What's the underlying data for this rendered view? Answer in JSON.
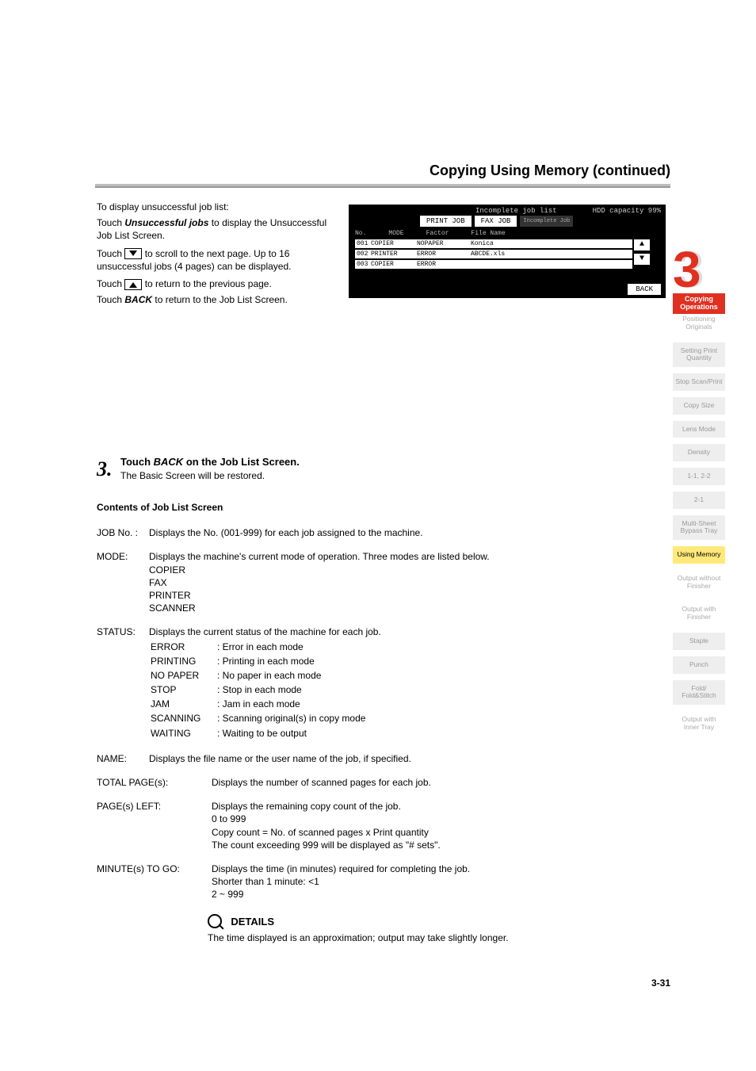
{
  "title": "Copying Using Memory (continued)",
  "intro": {
    "heading": "To display unsuccessful job list:",
    "line1_pre": "Touch ",
    "line1_em": "Unsuccessful jobs",
    "line1_post": " to display the Unsuccessful Job List Screen.",
    "line2_pre": "Touch ",
    "line2_post": " to scroll to the next page. Up to 16 unsuccessful jobs (4 pages) can be displayed.",
    "line3_pre": "Touch ",
    "line3_post": " to return to the previous page.",
    "line4_pre": "Touch ",
    "line4_em": "BACK",
    "line4_post": " to return to the Job List Screen."
  },
  "step3": {
    "num": "3.",
    "head_pre": "Touch ",
    "head_em": "BACK",
    "head_post": " on the Job List Screen.",
    "body": "The Basic Screen will be restored."
  },
  "contents_heading": "Contents of Job List Screen",
  "defs": {
    "jobno_label": "JOB No. :",
    "jobno_body": "Displays the No. (001-999) for each job assigned to the machine.",
    "mode_label": "MODE:",
    "mode_body": "Displays the machine's current mode of operation. Three modes are listed below.",
    "mode_items": [
      "COPIER",
      "FAX",
      "PRINTER",
      "SCANNER"
    ],
    "status_label": "STATUS:",
    "status_body": "Displays the current status of the machine for each job.",
    "status_rows": [
      [
        "ERROR",
        ": Error in each mode"
      ],
      [
        "PRINTING",
        ": Printing in each mode"
      ],
      [
        "NO PAPER",
        ": No paper in each mode"
      ],
      [
        "STOP",
        ": Stop in each mode"
      ],
      [
        "JAM",
        ": Jam in each mode"
      ],
      [
        "SCANNING",
        ": Scanning original(s) in copy mode"
      ],
      [
        "WAITING",
        ": Waiting to be output"
      ]
    ],
    "name_label": "NAME:",
    "name_body": "Displays the file name or the user name of the job, if specified.",
    "total_label": "TOTAL PAGE(s):",
    "total_body": "Displays the number of scanned pages for each job.",
    "pages_label": "PAGE(s) LEFT:",
    "pages_body1": "Displays the remaining copy count of the job.",
    "pages_body2": "0 to 999",
    "pages_body3": "Copy count = No. of scanned pages x Print quantity",
    "pages_body4": "The count exceeding 999 will be displayed as \"# sets\".",
    "minute_label": "MINUTE(s) TO GO:",
    "minute_body1": "Displays the time (in minutes) required for completing the job.",
    "minute_body2": "Shorter than 1 minute: <1",
    "minute_body3": "2 ~ 999"
  },
  "details": {
    "heading": "DETAILS",
    "body": "The time displayed is an approximation; output may take slightly longer."
  },
  "screenshot": {
    "header": "Incomplete job list",
    "hdd": "HDD capacity 99%",
    "tabs": [
      "PRINT JOB",
      "FAX JOB",
      "Incomplete Job"
    ],
    "cols": [
      "No.",
      "MODE",
      "Factor",
      "File Name"
    ],
    "rows": [
      {
        "no": "001",
        "mode": "COPIER",
        "factor": "NOPAPER",
        "name": "Konica"
      },
      {
        "no": "002",
        "mode": "PRINTER",
        "factor": "ERROR",
        "name": "ABCDE.xls"
      },
      {
        "no": "003",
        "mode": "COPIER",
        "factor": "ERROR",
        "name": ""
      }
    ],
    "back": "BACK"
  },
  "chapter": {
    "num": "3",
    "label1": "Copying",
    "label2": "Operations"
  },
  "nav": [
    {
      "text": "Positioning Originals",
      "style": "plain"
    },
    {
      "text": "Setting Print Quantity",
      "style": "shaded"
    },
    {
      "text": "Stop Scan/Print",
      "style": "shaded"
    },
    {
      "text": "Copy Size",
      "style": "shaded"
    },
    {
      "text": "Lens Mode",
      "style": "shaded"
    },
    {
      "text": "Density",
      "style": "shaded"
    },
    {
      "text": "1-1, 2-2",
      "style": "shaded"
    },
    {
      "text": "2-1",
      "style": "shaded"
    },
    {
      "text": "Multi-Sheet Bypass Tray",
      "style": "shaded"
    },
    {
      "text": "Using Memory",
      "style": "active"
    },
    {
      "text": "Output without Finisher",
      "style": "plain"
    },
    {
      "text": "Output with Finisher",
      "style": "plain"
    },
    {
      "text": "Staple",
      "style": "shaded"
    },
    {
      "text": "Punch",
      "style": "shaded"
    },
    {
      "text": "Fold/ Fold&Stitch",
      "style": "shaded"
    },
    {
      "text": "Output with Inner Tray",
      "style": "plain"
    }
  ],
  "page_num": "3-31"
}
